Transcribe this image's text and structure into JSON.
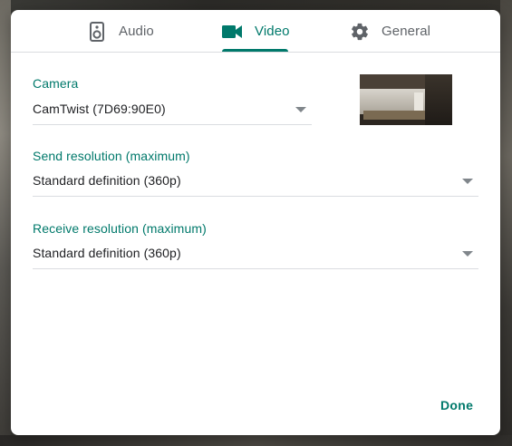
{
  "tabs": [
    {
      "label": "Audio",
      "icon": "speaker-icon",
      "active": false
    },
    {
      "label": "Video",
      "icon": "videocam-icon",
      "active": true
    },
    {
      "label": "General",
      "icon": "gear-icon",
      "active": false
    }
  ],
  "camera": {
    "label": "Camera",
    "value": "CamTwist (7D69:90E0)"
  },
  "send_resolution": {
    "label": "Send resolution (maximum)",
    "value": "Standard definition (360p)"
  },
  "receive_resolution": {
    "label": "Receive resolution (maximum)",
    "value": "Standard definition (360p)"
  },
  "done_label": "Done",
  "colors": {
    "accent": "#00796b",
    "inactive": "#5f6368",
    "text": "#202124",
    "divider": "#dadce0"
  }
}
